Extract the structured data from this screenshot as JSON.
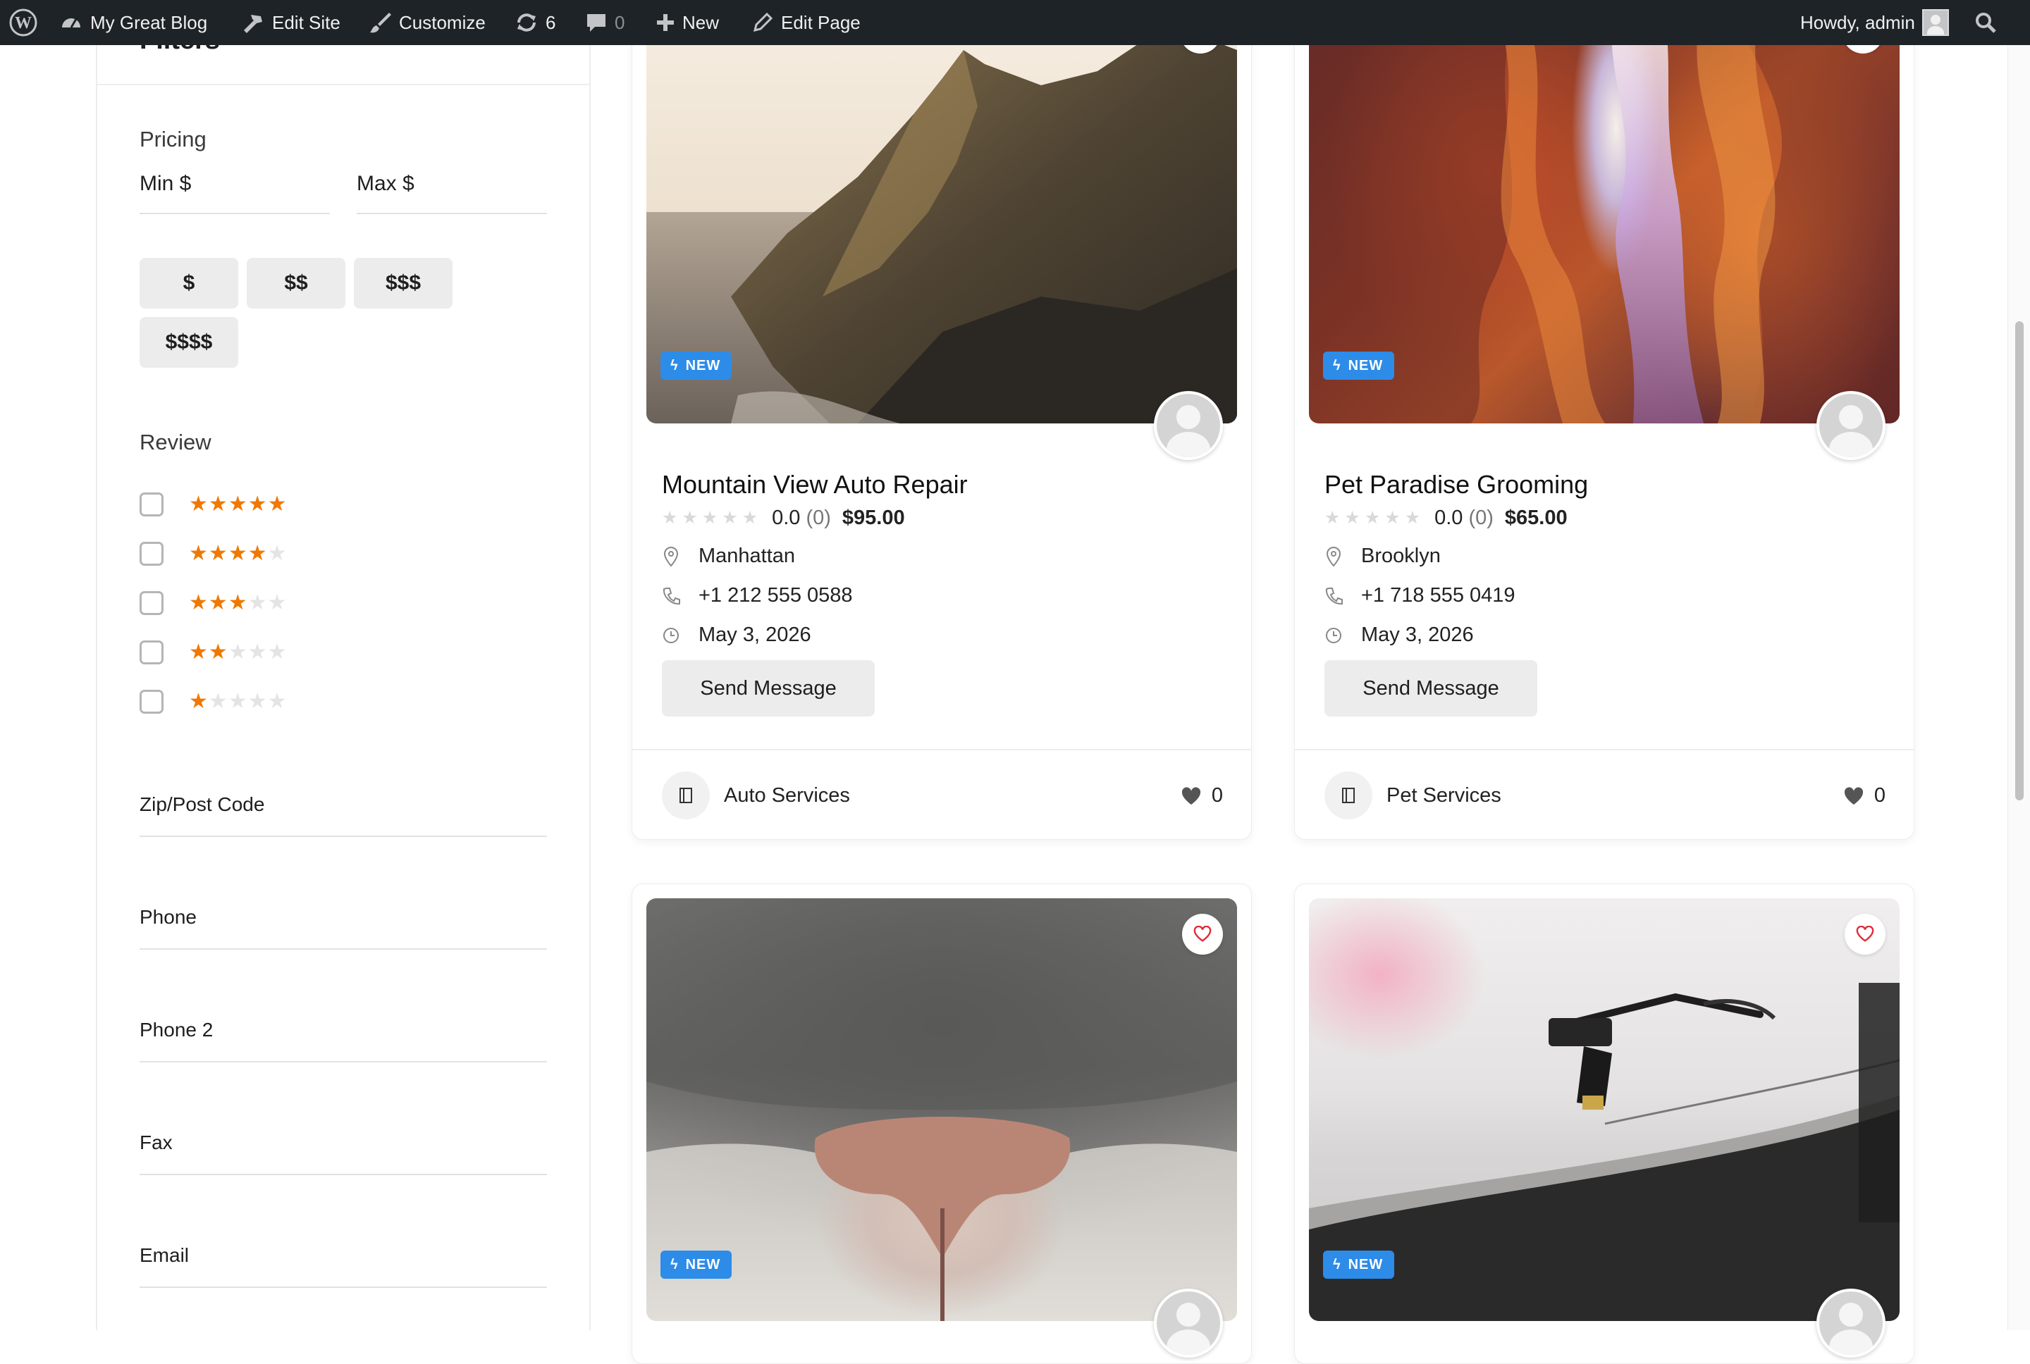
{
  "admin_bar": {
    "site_name": "My Great Blog",
    "edit_site": "Edit Site",
    "customize": "Customize",
    "updates_count": "6",
    "comments_count": "0",
    "new_label": "New",
    "edit_page": "Edit Page",
    "howdy": "Howdy, admin"
  },
  "sidebar": {
    "title": "Filters",
    "pricing": {
      "title": "Pricing",
      "min_label": "Min $",
      "max_label": "Max $",
      "price_levels": [
        "$",
        "$$",
        "$$$",
        "$$$$"
      ]
    },
    "review": {
      "title": "Review",
      "star_options": [
        5,
        4,
        3,
        2,
        1
      ]
    },
    "fields": [
      "Zip/Post Code",
      "Phone",
      "Phone 2",
      "Fax",
      "Email"
    ]
  },
  "colors": {
    "admin_bar_bg": "#1d2327",
    "star_active": "#f07800",
    "badge_blue": "#2d8ce8",
    "heart_red": "#e02b3c"
  },
  "listings": [
    {
      "badge": "NEW",
      "title": "Mountain View Auto Repair",
      "rating": "0.0",
      "review_count": "(0)",
      "price": "$95.00",
      "location": "Manhattan",
      "phone": "+1 212 555 0588",
      "date": "May 3, 2026",
      "button": "Send Message",
      "category": "Auto Services",
      "favorites": "0"
    },
    {
      "badge": "NEW",
      "title": "Pet Paradise Grooming",
      "rating": "0.0",
      "review_count": "(0)",
      "price": "$65.00",
      "location": "Brooklyn",
      "phone": "+1 718 555 0419",
      "date": "May 3, 2026",
      "button": "Send Message",
      "category": "Pet Services",
      "favorites": "0"
    },
    {
      "badge": "NEW"
    },
    {
      "badge": "NEW"
    }
  ]
}
